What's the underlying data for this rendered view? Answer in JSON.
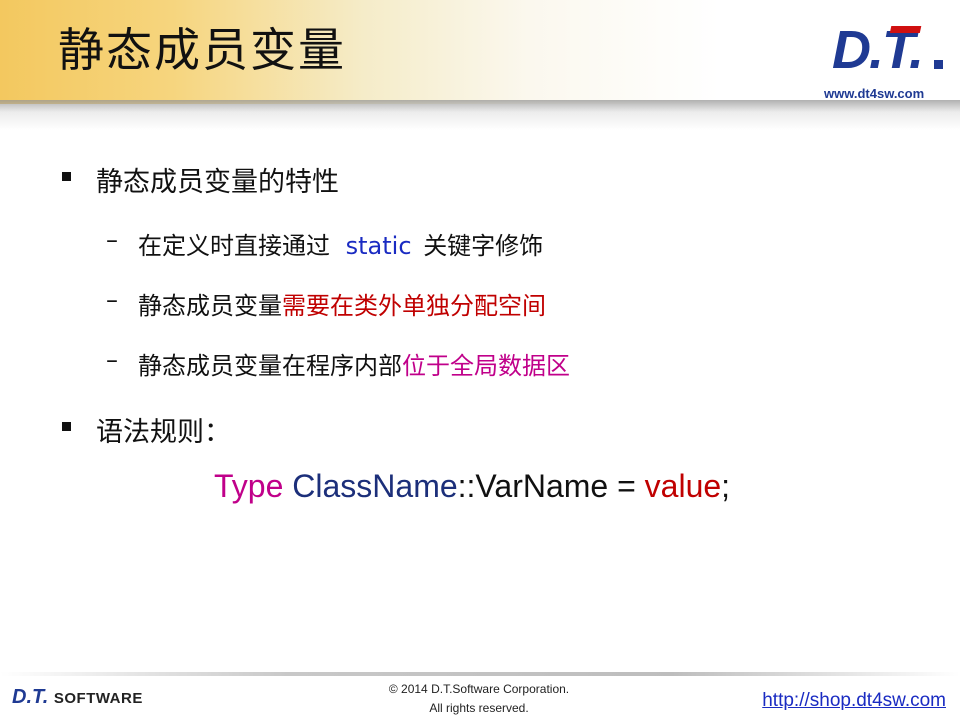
{
  "header": {
    "title": "静态成员变量",
    "logo_text": "D.T.",
    "logo_url": "www.dt4sw.com"
  },
  "content": {
    "bullet1": "静态成员变量的特性",
    "sub1": {
      "before": "在定义时直接通过",
      "keyword": "static",
      "after": "关键字修饰"
    },
    "sub2": {
      "before": "静态成员变量",
      "highlight": "需要在类外单独分配空间"
    },
    "sub3": {
      "before": "静态成员变量在程序内部",
      "highlight": "位于全局数据区"
    },
    "bullet2": "语法规则：",
    "code": {
      "type": "Type",
      "classname": "ClassName",
      "sep": "::",
      "varname": "VarName",
      "eq": " = ",
      "value": "value",
      "end": ";"
    }
  },
  "footer": {
    "logo_dt": "D.T.",
    "logo_software": "SOFTWARE",
    "copyright_line1": "© 2014 D.T.Software Corporation.",
    "copyright_line2": "All rights reserved.",
    "shop_link": "http://shop.dt4sw.com"
  },
  "colors": {
    "keyword_blue": "#1a2bc2",
    "highlight_red": "#c00000",
    "highlight_magenta": "#c0008a",
    "classname_navy": "#1c2f7a",
    "header_gold": "#f3c85f"
  }
}
